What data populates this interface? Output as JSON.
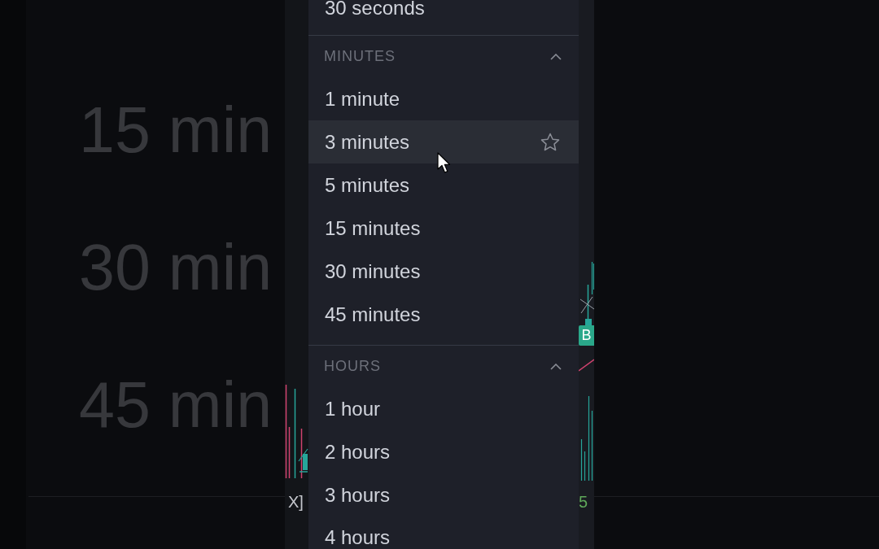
{
  "backdrop": {
    "texts": [
      "15 min",
      "30 min",
      "45 min"
    ]
  },
  "chart_edges": {
    "left_label": "X]",
    "badge": "B",
    "right_label": "5"
  },
  "menu": {
    "sections": [
      {
        "items": [
          {
            "label": "30 seconds",
            "hovered": false
          }
        ]
      },
      {
        "title": "MINUTES",
        "expanded": true,
        "items": [
          {
            "label": "1 minute",
            "hovered": false
          },
          {
            "label": "3 minutes",
            "hovered": true
          },
          {
            "label": "5 minutes",
            "hovered": false
          },
          {
            "label": "15 minutes",
            "hovered": false
          },
          {
            "label": "30 minutes",
            "hovered": false
          },
          {
            "label": "45 minutes",
            "hovered": false
          }
        ]
      },
      {
        "title": "HOURS",
        "expanded": true,
        "items": [
          {
            "label": "1 hour",
            "hovered": false
          },
          {
            "label": "2 hours",
            "hovered": false
          },
          {
            "label": "3 hours",
            "hovered": false
          },
          {
            "label": "4 hours",
            "hovered": false
          }
        ]
      }
    ]
  }
}
